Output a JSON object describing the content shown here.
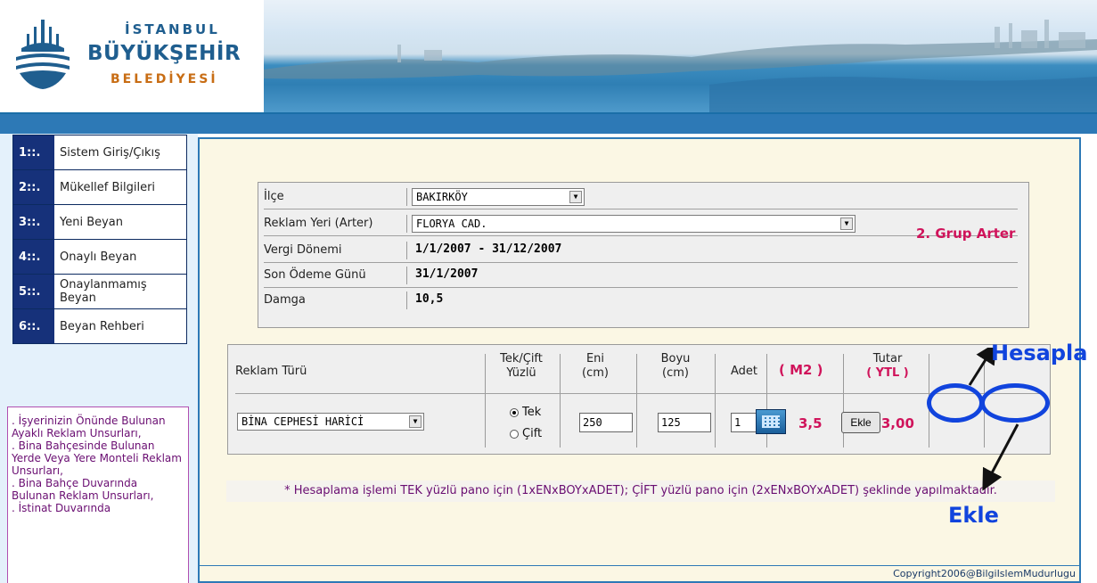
{
  "header": {
    "logo_line1": "İSTANBUL",
    "logo_line2": "BÜYÜKŞEHİR",
    "logo_line3": "BELEDİYESİ"
  },
  "sidebar": {
    "items": [
      {
        "num": "1::.",
        "label": "Sistem Giriş/Çıkış"
      },
      {
        "num": "2::.",
        "label": "Mükellef Bilgileri"
      },
      {
        "num": "3::.",
        "label": "Yeni Beyan"
      },
      {
        "num": "4::.",
        "label": "Onaylı Beyan"
      },
      {
        "num": "5::.",
        "label": "Onaylanmamış Beyan"
      },
      {
        "num": "6::.",
        "label": "Beyan Rehberi"
      }
    ],
    "notes": [
      ". İşyerinizin Önünde Bulunan Ayaklı Reklam Unsurları,",
      ". Bina Bahçesinde Bulunan Yerde Veya Yere Monteli Reklam Unsurları,",
      ". Bina Bahçe Duvarında Bulunan Reklam Unsurları,",
      ". İstinat Duvarında"
    ]
  },
  "info": {
    "ilce_label": "İlçe",
    "ilce_value": "BAKIRKÖY",
    "reklam_yeri_label": "Reklam Yeri (Arter)",
    "reklam_yeri_value": "FLORYA CAD.",
    "grup": "2. Grup Arter",
    "vergi_donemi_label": "Vergi Dönemi",
    "vergi_donemi_value": "1/1/2007 - 31/12/2007",
    "son_odeme_label": "Son Ödeme Günü",
    "son_odeme_value": "31/1/2007",
    "damga_label": "Damga",
    "damga_value": "10,5"
  },
  "calc": {
    "headers": {
      "reklam_turu": "Reklam Türü",
      "tek_cift": "Tek/Çift Yüzlü",
      "eni": "Eni (cm)",
      "boyu": "Boyu (cm)",
      "adet": "Adet",
      "m2": "( M2 )",
      "tutar": "Tutar",
      "tutar_unit": "( YTL )"
    },
    "reklam_turu_value": "BİNA CEPHESİ HARİCİ",
    "radio_tek": "Tek",
    "radio_cift": "Çift",
    "selected": "Tek",
    "eni_value": "250",
    "boyu_value": "125",
    "adet_value": "1",
    "m2_value": "3,5",
    "tutar_value": "973,00",
    "ekle_button": "Ekle"
  },
  "footnote": "* Hesaplama işlemi TEK yüzlü pano için (1xENxBOYxADET); ÇİFT yüzlü pano için (2xENxBOYxADET) şeklinde yapılmaktadır.",
  "copyright": "Copyright2006@BilgiIslemMudurlugu",
  "annotations": {
    "hesapla": "Hesapla",
    "ekle": "Ekle"
  },
  "colors": {
    "accent_blue": "#2d79b6",
    "menu_blue": "#16317a",
    "highlight_red": "#d0145b",
    "annotation_blue": "#1144dd"
  }
}
